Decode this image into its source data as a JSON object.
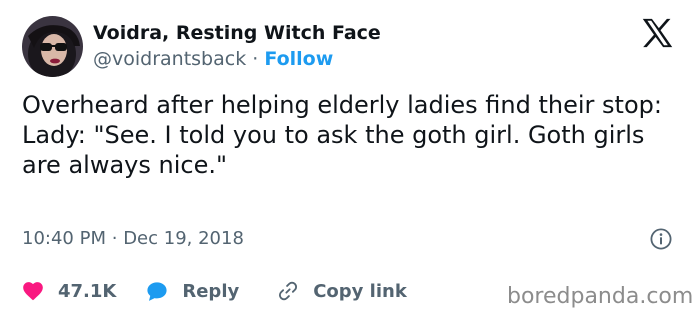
{
  "author": {
    "display_name": "Voidra, Resting Witch Face",
    "handle": "@voidrantsback",
    "separator": "·",
    "follow_label": "Follow",
    "avatar_icon": "profile-avatar"
  },
  "brand": {
    "logo_icon": "x-logo-icon"
  },
  "tweet": {
    "line1": "Overheard after helping elderly ladies find their stop:",
    "line2": "Lady: \"See. I told you to ask the goth girl. Goth girls are always nice.\""
  },
  "meta": {
    "time": "10:40 PM",
    "separator": "·",
    "date": "Dec 19, 2018",
    "info_icon": "info-icon"
  },
  "actions": {
    "like_count": "47.1K",
    "reply_label": "Reply",
    "copy_link_label": "Copy link"
  },
  "watermark": "boredpanda.com",
  "colors": {
    "accent": "#1d9bf0",
    "like_heart": "#f91880",
    "text_primary": "#0f1419",
    "text_secondary": "#536471"
  }
}
